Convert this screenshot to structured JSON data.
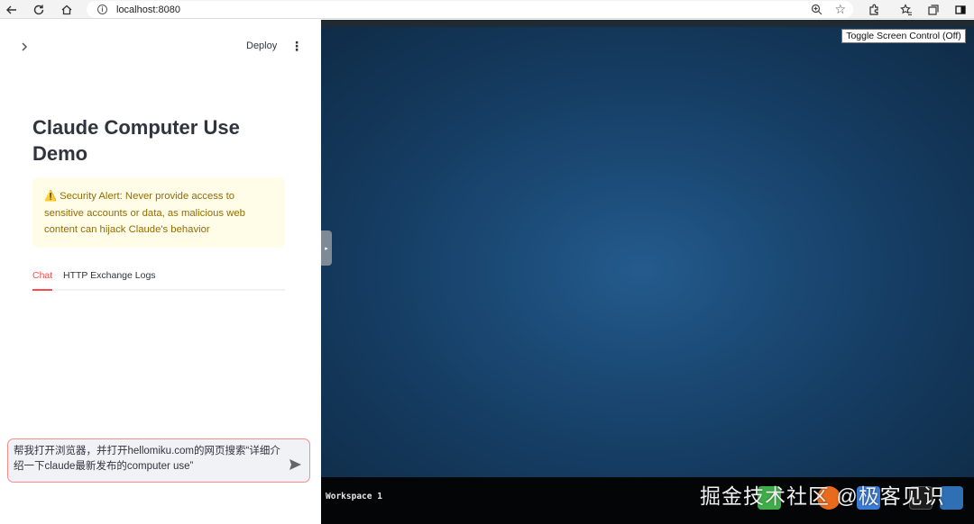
{
  "browser": {
    "url": "localhost:8080",
    "icons": [
      "back-icon",
      "reload-icon",
      "home-icon",
      "info-icon",
      "zoom-icon",
      "star-icon",
      "extensions-icon",
      "favorites-icon",
      "collections-icon",
      "sidebar-icon"
    ]
  },
  "header": {
    "deploy_label": "Deploy",
    "expand_icon": "chevron-right-icon",
    "menu_icon": "kebab-menu-icon"
  },
  "main": {
    "title": "Claude Computer Use Demo",
    "alert": {
      "icon": "⚠️",
      "text": "Security Alert: Never provide access to sensitive accounts or data, as malicious web content can hijack Claude's behavior"
    },
    "tabs": [
      {
        "label": "Chat",
        "active": true
      },
      {
        "label": "HTTP Exchange Logs",
        "active": false
      }
    ]
  },
  "chat_input": {
    "value": "帮我打开浏览器，并打开hellomiku.com的网页搜索“详细介绍一下claude最新发布的computer use”",
    "send_icon": "send-icon"
  },
  "vnc": {
    "toggle_label": "Toggle Screen Control (Off)",
    "workspace_label": "Workspace 1",
    "handle_glyph": "▸"
  },
  "watermark": "掘金技术社区 @极客见识",
  "colors": {
    "accent": "#ff4b4b",
    "alert_bg": "#fffce7",
    "alert_text": "#926c05",
    "desktop_bg": "#1b4a76",
    "taskbar_bg": "#030507"
  }
}
